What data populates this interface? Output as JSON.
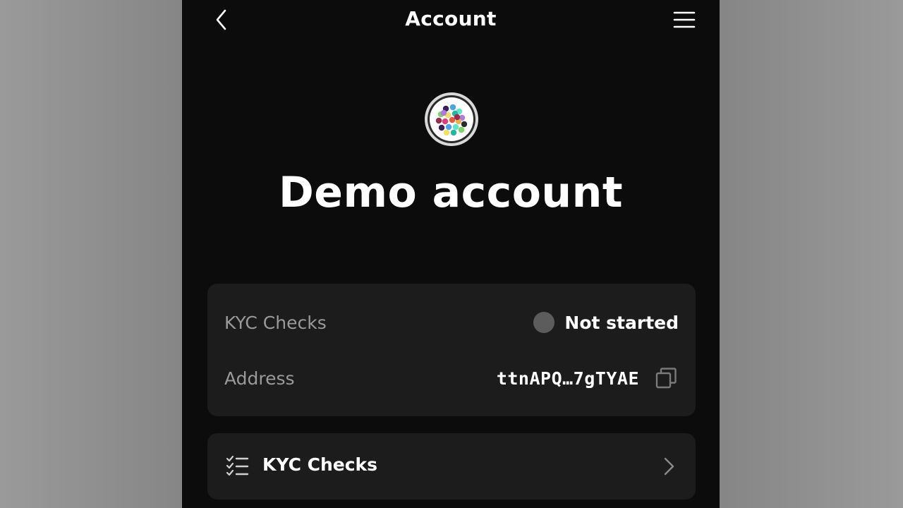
{
  "header": {
    "title": "Account",
    "back_icon": "chevron-left-icon",
    "menu_icon": "hamburger-menu-icon"
  },
  "profile": {
    "avatar_icon": "dotted-avatar-icon",
    "name": "Demo account"
  },
  "info_card": {
    "kyc": {
      "label": "KYC Checks",
      "status": "Not started",
      "status_color": "#5c5c5c"
    },
    "address": {
      "label": "Address",
      "value": "ttnAPQ…7gTYAE",
      "copy_icon": "copy-icon"
    }
  },
  "nav": {
    "kyc_checks": {
      "label": "KYC Checks",
      "icon": "checklist-icon",
      "chevron_icon": "chevron-right-icon"
    }
  },
  "colors": {
    "background": "#0c0c0c",
    "card": "#1c1c1c",
    "text_primary": "#ffffff",
    "text_secondary": "#9a9a9a"
  }
}
